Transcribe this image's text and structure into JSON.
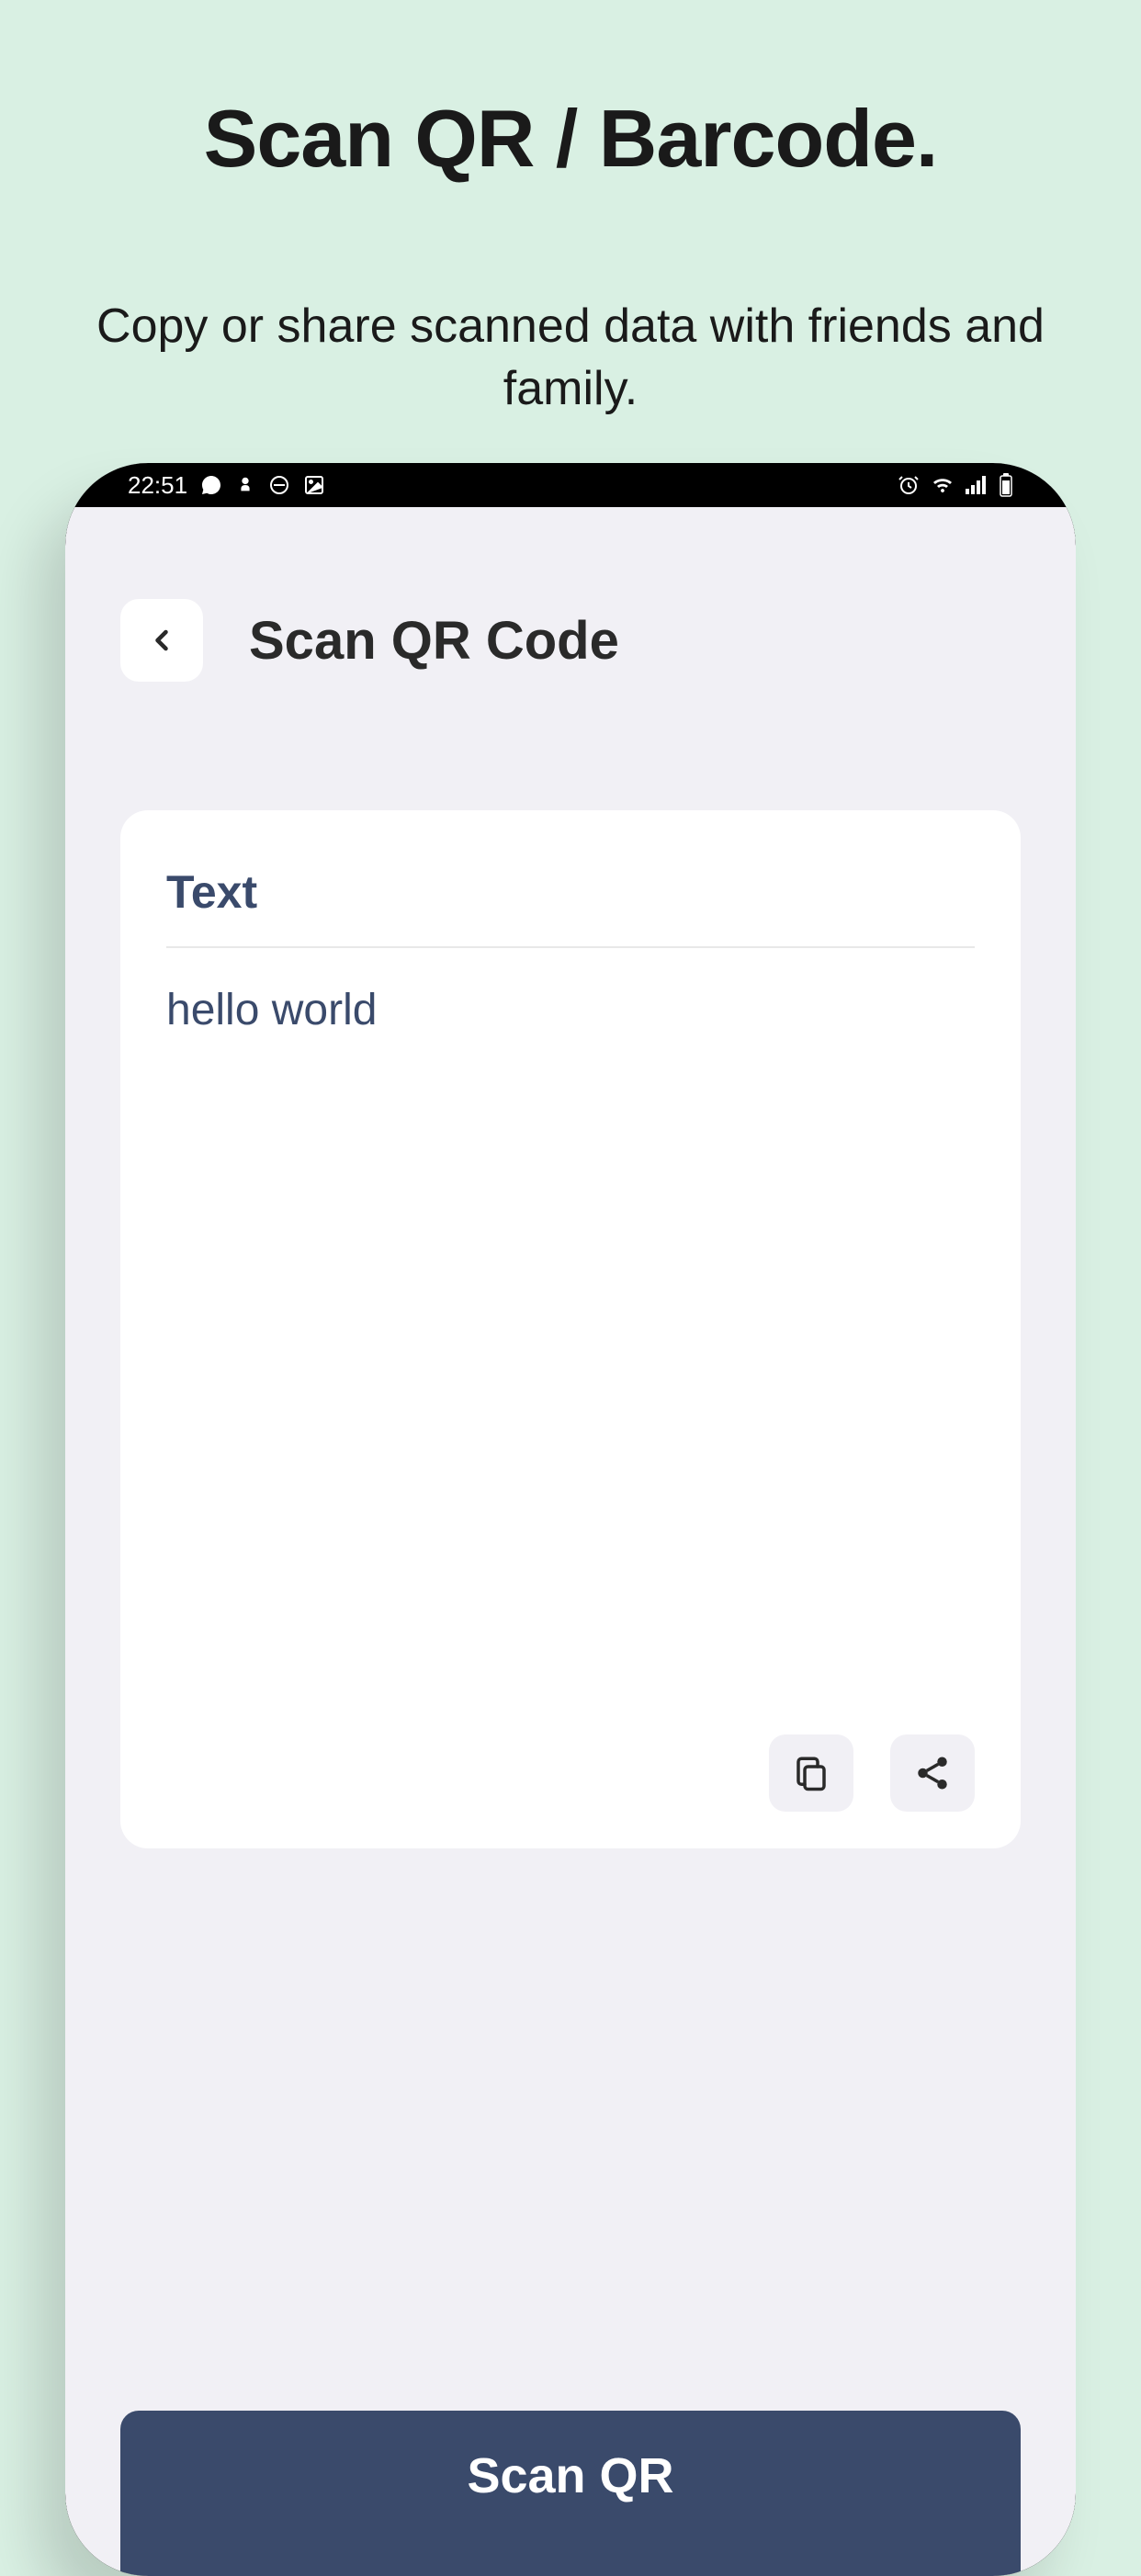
{
  "promo": {
    "title": "Scan QR / Barcode.",
    "subtitle": "Copy or share scanned data with friends and family."
  },
  "status_bar": {
    "time": "22:51"
  },
  "app_header": {
    "title": "Scan QR Code"
  },
  "result_card": {
    "label": "Text",
    "content": "hello world"
  },
  "scan_button": {
    "label": "Scan QR"
  },
  "icons": {
    "back": "back-chevron-icon",
    "copy": "copy-icon",
    "share": "share-icon"
  }
}
